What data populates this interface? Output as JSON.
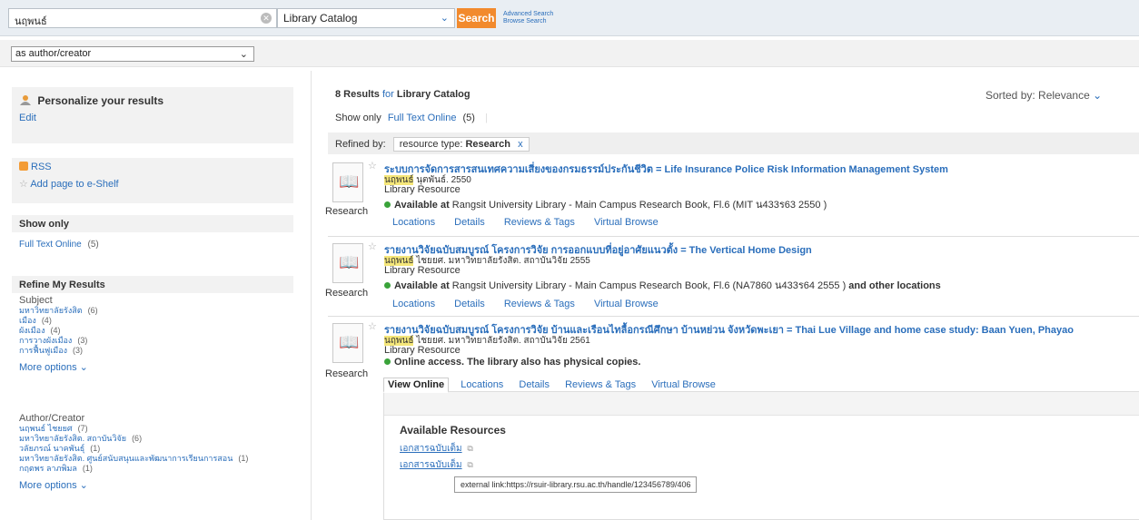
{
  "search": {
    "query": "นฤพนธ์",
    "scope": "Library Catalog",
    "button": "Search",
    "advanced": "Advanced Search",
    "browse": "Browse Search"
  },
  "type_select": "as author/creator",
  "left": {
    "personalize": "Personalize your results",
    "edit": "Edit",
    "rss": "RSS",
    "add_page": "Add page to e-Shelf",
    "show_only_head": "Show only",
    "show_only_item": "Full Text Online",
    "show_only_count": "(5)",
    "refine_head": "Refine My Results",
    "subject_head": "Subject",
    "subjects": [
      {
        "label": "มหาวิทยาลัยรังสิต",
        "count": "(6)"
      },
      {
        "label": "เมือง",
        "count": "(4)"
      },
      {
        "label": "ผังเมือง",
        "count": "(4)"
      },
      {
        "label": "การวางผังเมือง",
        "count": "(3)"
      },
      {
        "label": "การฟื้นฟูเมือง",
        "count": "(3)"
      }
    ],
    "more1": "More options",
    "author_head": "Author/Creator",
    "authors": [
      {
        "label": "นฤพนธ์ ไชยยศ",
        "count": "(7)"
      },
      {
        "label": "มหาวิทยาลัยรังสิต. สถาบันวิจัย",
        "count": "(6)"
      },
      {
        "label": "วลัยภรณ์ นาคพันธุ์",
        "count": "(1)"
      },
      {
        "label": "มหาวิทยาลัยรังสิต. ศูนย์สนับสนุนและพัฒนาการเรียนการสอน",
        "count": "(1)"
      },
      {
        "label": "กฤตพร ลาภพิมล",
        "count": "(1)"
      }
    ],
    "more2": "More options"
  },
  "results": {
    "count": "8 Results",
    "for": "for",
    "catalog": "Library Catalog",
    "sorted_label": "Sorted by:",
    "sorted_value": "Relevance",
    "show_only": "Show only",
    "fulltext": "Full Text Online",
    "fulltext_count": "(5)",
    "refined_by": "Refined by:",
    "chip_label": "resource type:",
    "chip_value": "Research",
    "chip_x": "x"
  },
  "items": [
    {
      "title": "ระบบการจัดการสารสนเทศความเสี่ยงของกรมธรรม์ประกันชีวิต = Life Insurance Police Risk Information Management System",
      "author_hl": "นฤพนธ์",
      "author_rest": " นุตพันธ์. 2550",
      "resource": "Library Resource",
      "avail_bold": "Available at",
      "avail_rest": " Rangsit University Library - Main Campus Research Book, Fl.6 (MIT น433ร63 2550 )",
      "avail_extra": "",
      "type": "Research",
      "tabs": [
        "Locations",
        "Details",
        "Reviews & Tags",
        "Virtual Browse"
      ]
    },
    {
      "title": "รายงานวิจัยฉบับสมบูรณ์ โครงการวิจัย การออกแบบที่อยู่อาศัยแนวตั้ง = The Vertical Home Design",
      "author_hl": "นฤพนธ์",
      "author_rest": " ไชยยศ. มหาวิทยาลัยรังสิต. สถาบันวิจัย 2555",
      "resource": "Library Resource",
      "avail_bold": "Available at",
      "avail_rest": " Rangsit University Library - Main Campus Research Book, Fl.6 (NA7860 น433ร64 2555 )",
      "avail_extra": " and other locations",
      "type": "Research",
      "tabs": [
        "Locations",
        "Details",
        "Reviews & Tags",
        "Virtual Browse"
      ]
    },
    {
      "title": "รายงานวิจัยฉบับสมบูรณ์ โครงการวิจัย บ้านและเรือนไทลื้อกรณีศึกษา บ้านหย่วน จังหวัดพะเยา = Thai Lue Village and home case study: Baan Yuen, Phayao",
      "author_hl": "นฤพนธ์",
      "author_rest": " ไชยยศ. มหาวิทยาลัยรังสิต. สถาบันวิจัย 2561",
      "resource": "Library Resource",
      "avail_bold": "Online access. The library also has physical copies.",
      "avail_rest": "",
      "avail_extra": "",
      "type": "Research",
      "tabs": [
        "View Online",
        "Locations",
        "Details",
        "Reviews & Tags",
        "Virtual Browse"
      ]
    }
  ],
  "panel": {
    "head": "Available Resources",
    "link1": "เอกสารฉบับเต็ม",
    "link2": "เอกสารฉบับเต็ม",
    "tooltip": "external link:https://rsuir-library.rsu.ac.th/handle/123456789/406"
  }
}
